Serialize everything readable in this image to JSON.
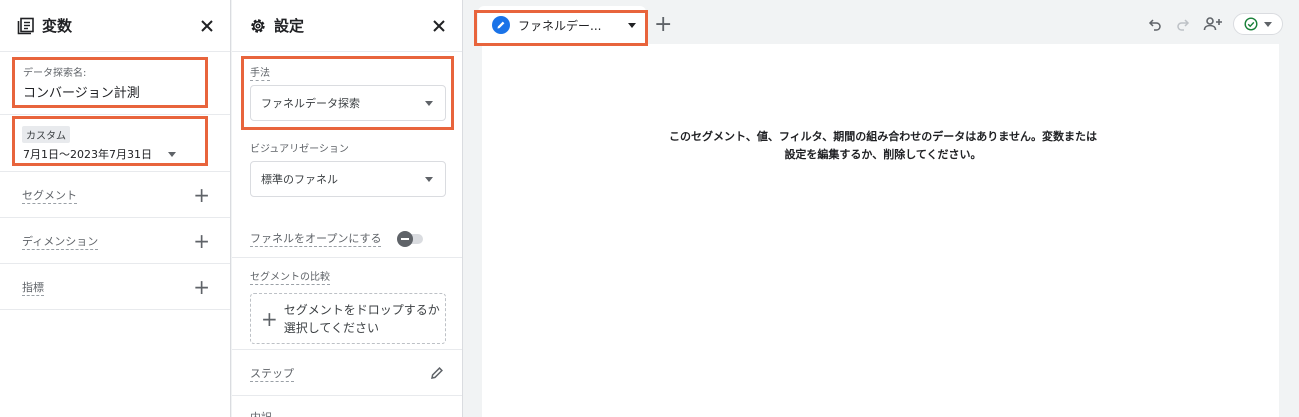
{
  "variables_panel": {
    "title": "変数",
    "exploration_name_label": "データ探索名:",
    "exploration_name": "コンバージョン計測",
    "date_chip": "カスタム",
    "date_range": "7月1日～2023年7月31日",
    "rows": [
      {
        "label": "セグメント"
      },
      {
        "label": "ディメンション"
      },
      {
        "label": "指標"
      }
    ]
  },
  "settings_panel": {
    "title": "設定",
    "method_label": "手法",
    "method_value": "ファネルデータ探索",
    "visualization_label": "ビジュアリゼーション",
    "visualization_value": "標準のファネル",
    "open_funnel_label": "ファネルをオープンにする",
    "segment_compare_label": "セグメントの比較",
    "drop_zone_text": "セグメントをドロップするか選択してください",
    "steps_label": "ステップ",
    "breakdown_label": "内訳"
  },
  "canvas": {
    "tab_label": "ファネルデー...",
    "empty_message": "このセグメント、値、フィルタ、期間の組み合わせのデータはありません。変数または設定を編集するか、削除してください。"
  },
  "colors": {
    "highlight": "#e8643c",
    "accent": "#1a73e8",
    "status_ok": "#188038"
  }
}
